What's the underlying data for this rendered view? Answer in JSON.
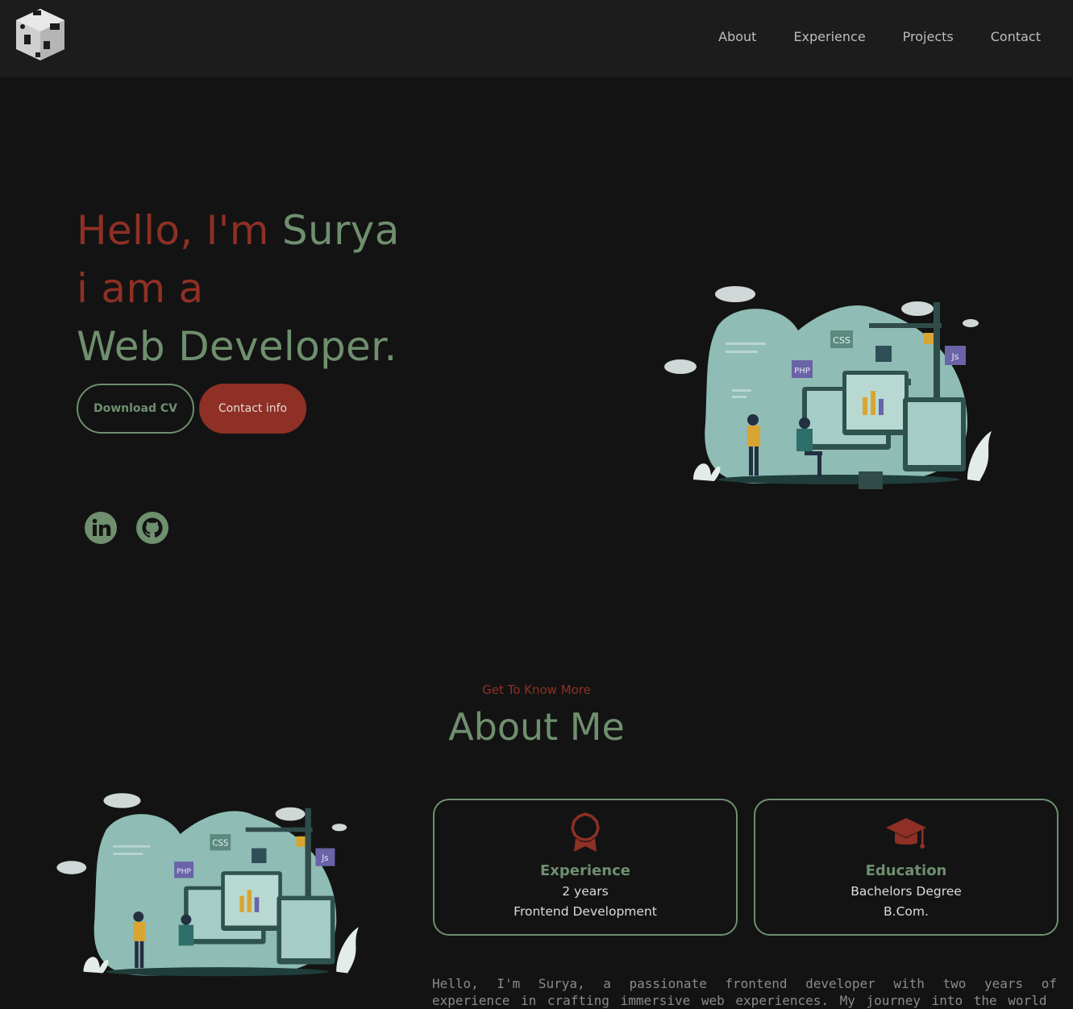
{
  "nav": {
    "items": [
      "About",
      "Experience",
      "Projects",
      "Contact"
    ]
  },
  "hero": {
    "greeting": "Hello, I'm ",
    "name": "Surya",
    "line2": "i am a",
    "line3": "Web Developer.",
    "download_label": "Download CV",
    "contact_label": "Contact info"
  },
  "about": {
    "subtitle": "Get To Know More",
    "title": "About Me",
    "cards": [
      {
        "title": "Experience",
        "line1": "2 years",
        "line2": "Frontend Development"
      },
      {
        "title": "Education",
        "line1": "Bachelors Degree",
        "line2": "B.Com."
      }
    ],
    "paragraph": "Hello, I'm Surya, a passionate frontend developer with two years of experience in crafting immersive web experiences. My journey into the world"
  },
  "illustration": {
    "labels": [
      "CSS",
      "PHP",
      "Js"
    ]
  },
  "colors": {
    "accent_red": "#8e3025",
    "accent_green": "#6f8f6e",
    "background": "#131313",
    "header": "#1c1c1c"
  },
  "icons": [
    "logo-cube-icon",
    "linkedin-icon",
    "github-icon",
    "award-icon",
    "graduation-cap-icon"
  ]
}
